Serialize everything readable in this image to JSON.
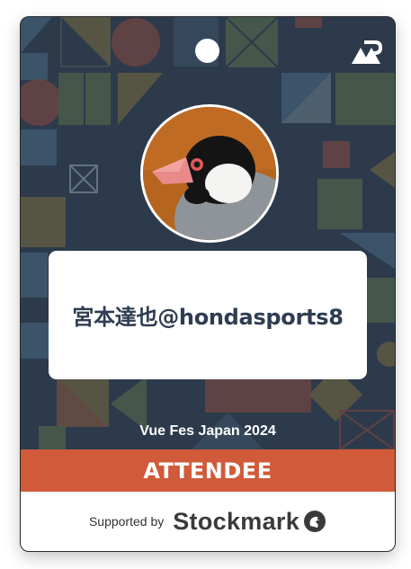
{
  "badge": {
    "attendee_name": "宮本達也@hondasports8",
    "event_name": "Vue Fes Japan 2024",
    "role": "ATTENDEE",
    "supported_by_label": "Supported by",
    "sponsor_name": "Stockmark"
  },
  "icons": {
    "logo": "vue-fes-logo-icon",
    "sponsor_logo": "stockmark-squirrel-icon",
    "avatar": "java-sparrow-avatar"
  },
  "colors": {
    "background": "#2c3a4c",
    "role_band": "#d05a3a",
    "name_text": "#2f3d52",
    "avatar_bg": "#b5651d"
  }
}
